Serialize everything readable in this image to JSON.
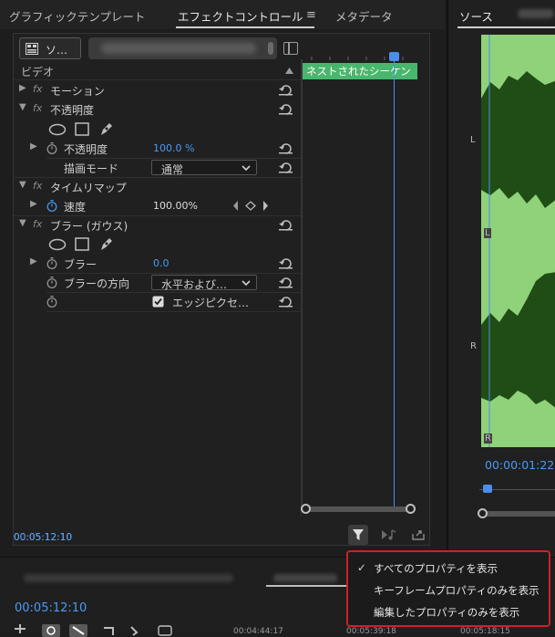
{
  "tabs": {
    "graphic_templates": "グラフィックテンプレート",
    "effect_controls": "エフェクトコントロール",
    "menu": "≡",
    "metadata": "メタデータ",
    "source": "ソース"
  },
  "source_selector": {
    "label": "ソ…"
  },
  "effect_controls": {
    "section_video": "ビデオ",
    "motion": "モーション",
    "opacity": "不透明度",
    "opacity_prop": "不透明度",
    "opacity_value": "100.0 %",
    "blend_mode_label": "描画モード",
    "blend_mode_value": "通常",
    "time_remap": "タイムリマップ",
    "speed_label": "速度",
    "speed_value": "100.00%",
    "blur_effect": "ブラー (ガウス)",
    "blur_label": "ブラー",
    "blur_value": "0.0",
    "blur_dir_label": "ブラーの方向",
    "blur_dir_value": "水平および…",
    "edge_label": "エッジピクセ…",
    "fx_glyph": "fx"
  },
  "timeline": {
    "clip_label": "ネストされたシーケン"
  },
  "footer": {
    "timecode": "00:05:12:10"
  },
  "right": {
    "timecode": "00:00:01:22",
    "left_channel": "L",
    "right_channel": "R"
  },
  "bottom": {
    "timecode": "00:05:12:10",
    "time_mark": "00:04:44:17",
    "time_mark_2": "00:05:39:18",
    "time_mark_3": "00:05:18:15"
  },
  "popup_menu": {
    "items": [
      {
        "label": "すべてのプロパティを表示",
        "checked": "✓"
      },
      {
        "label": "キーフレームプロパティのみを表示",
        "checked": ""
      },
      {
        "label": "編集したプロパティのみを表示",
        "checked": ""
      }
    ]
  },
  "colors": {
    "accent": "#4a9af4",
    "clip_green": "#49b66d",
    "wave_bg": "#8fd27a",
    "wave_fg": "#1f4d15",
    "highlight": "#d21f26"
  }
}
